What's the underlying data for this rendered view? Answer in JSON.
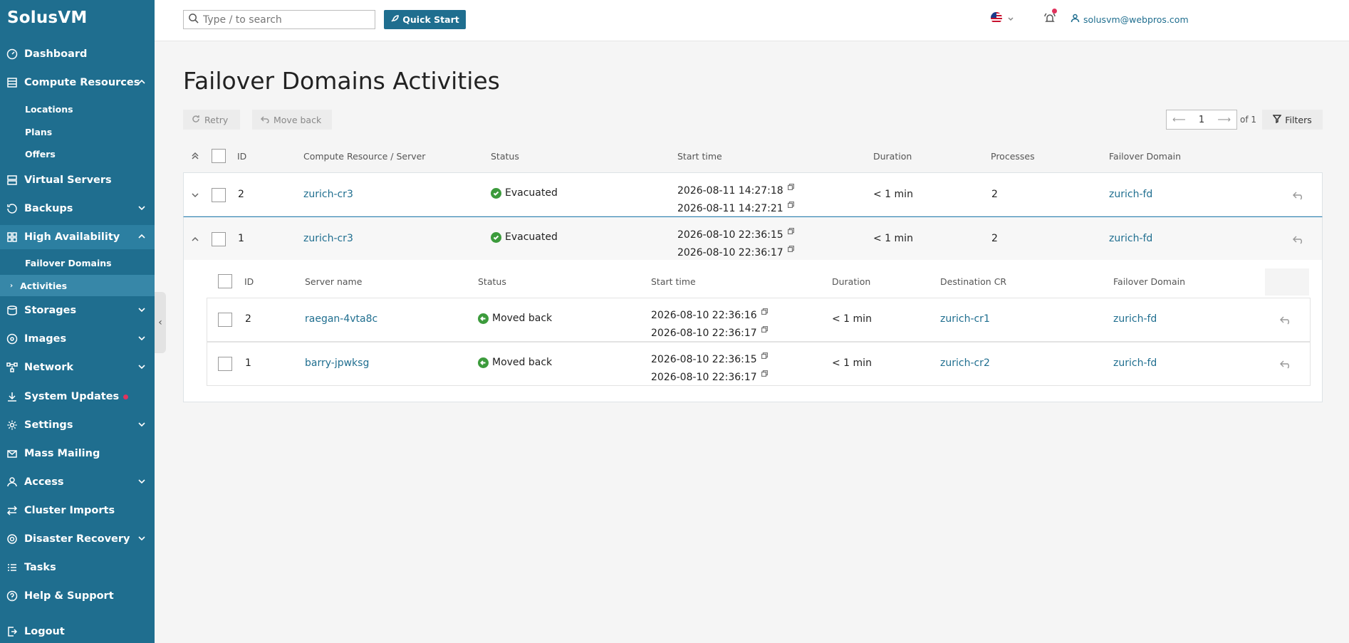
{
  "app": {
    "logo": "SolusVM"
  },
  "sidebar": {
    "items": [
      {
        "label": "Dashboard",
        "icon": "dashboard-icon"
      },
      {
        "label": "Compute Resources",
        "icon": "compute-icon",
        "chevron": "up"
      },
      {
        "label": "Virtual Servers",
        "icon": "server-icon"
      },
      {
        "label": "Backups",
        "icon": "backup-icon",
        "chevron": "down"
      },
      {
        "label": "High Availability",
        "icon": "grid-icon",
        "chevron": "up"
      },
      {
        "label": "Storages",
        "icon": "storage-icon",
        "chevron": "down"
      },
      {
        "label": "Images",
        "icon": "image-icon",
        "chevron": "down"
      },
      {
        "label": "Network",
        "icon": "network-icon",
        "chevron": "down"
      },
      {
        "label": "System Updates",
        "icon": "download-icon"
      },
      {
        "label": "Settings",
        "icon": "gear-icon",
        "chevron": "down"
      },
      {
        "label": "Mass Mailing",
        "icon": "mail-icon"
      },
      {
        "label": "Access",
        "icon": "user-icon",
        "chevron": "down"
      },
      {
        "label": "Cluster Imports",
        "icon": "swap-icon"
      },
      {
        "label": "Disaster Recovery",
        "icon": "recovery-icon",
        "chevron": "down"
      },
      {
        "label": "Tasks",
        "icon": "tasks-icon"
      },
      {
        "label": "Help & Support",
        "icon": "help-icon"
      },
      {
        "label": "Logout",
        "icon": "logout-icon"
      }
    ],
    "compute_sub": [
      "Locations",
      "Plans",
      "Offers"
    ],
    "ha_sub": [
      "Failover Domains",
      "Activities"
    ]
  },
  "header": {
    "search_placeholder": "Type / to search",
    "quick_start": "Quick Start",
    "user_email": "solusvm@webpros.com"
  },
  "page": {
    "title": "Failover Domains Activities",
    "retry": "Retry",
    "move_back": "Move back",
    "page_num": "1",
    "of_total": "of 1",
    "filters": "Filters"
  },
  "table": {
    "headers": [
      "ID",
      "Compute Resource / Server",
      "Status",
      "Start time",
      "Duration",
      "Processes",
      "Failover Domain"
    ],
    "rows": [
      {
        "id": "2",
        "server": "zurich-cr3",
        "status": "Evacuated",
        "start1": "2026-08-11 14:27:18",
        "start2": "2026-08-11 14:27:21",
        "duration": "< 1 min",
        "processes": "2",
        "domain": "zurich-fd"
      },
      {
        "id": "1",
        "server": "zurich-cr3",
        "status": "Evacuated",
        "start1": "2026-08-10 22:36:15",
        "start2": "2026-08-10 22:36:17",
        "duration": "< 1 min",
        "processes": "2",
        "domain": "zurich-fd"
      }
    ]
  },
  "inner": {
    "headers": [
      "ID",
      "Server name",
      "Status",
      "Start time",
      "Duration",
      "Destination CR",
      "Failover Domain"
    ],
    "rows": [
      {
        "id": "2",
        "server": "raegan-4vta8c",
        "status": "Moved back",
        "start1": "2026-08-10 22:36:16",
        "start2": "2026-08-10 22:36:17",
        "duration": "< 1 min",
        "dest": "zurich-cr1",
        "domain": "zurich-fd"
      },
      {
        "id": "1",
        "server": "barry-jpwksg",
        "status": "Moved back",
        "start1": "2026-08-10 22:36:15",
        "start2": "2026-08-10 22:36:17",
        "duration": "< 1 min",
        "dest": "zurich-cr2",
        "domain": "zurich-fd"
      }
    ]
  },
  "colors": {
    "sidebar": "#1f6e8f",
    "accent": "#1f6e8f",
    "success": "#3c9b3c",
    "alert": "#e0335d"
  }
}
